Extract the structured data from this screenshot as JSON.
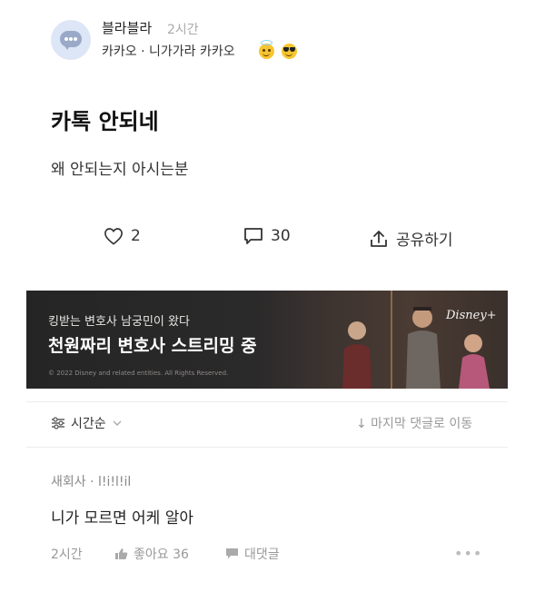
{
  "post": {
    "author": "블라블라",
    "time": "2시간",
    "board": "카카오 · 니가가라 카카오",
    "board_emojis": [
      "smiling-halo-emoji",
      "sunglasses-emoji"
    ],
    "title": "카톡 안되네",
    "body": "왜 안되는지 아시는분",
    "actions": {
      "likes": "2",
      "comments": "30",
      "share_label": "공유하기"
    }
  },
  "ad": {
    "subtitle": "킹받는 변호사 남궁민이 왔다",
    "headline": "천원짜리 변호사 스트리밍 중",
    "copyright": "© 2022 Disney and related entities. All Rights Reserved.",
    "brand": "Disney+"
  },
  "comments_bar": {
    "sort_label": "시간순",
    "jump_label": "↓ 마지막 댓글로 이동"
  },
  "comment": {
    "author": "새회사 · l!i!l!il",
    "text": "니가 모르면 어케 알아",
    "time": "2시간",
    "like_label": "좋아요 36",
    "reply_label": "대댓글",
    "more_label": "•••"
  },
  "colors": {
    "text": "#222222",
    "muted": "#999999",
    "avatar_bg": "#dde6f6",
    "banner_bg": "#2b2a2a"
  }
}
